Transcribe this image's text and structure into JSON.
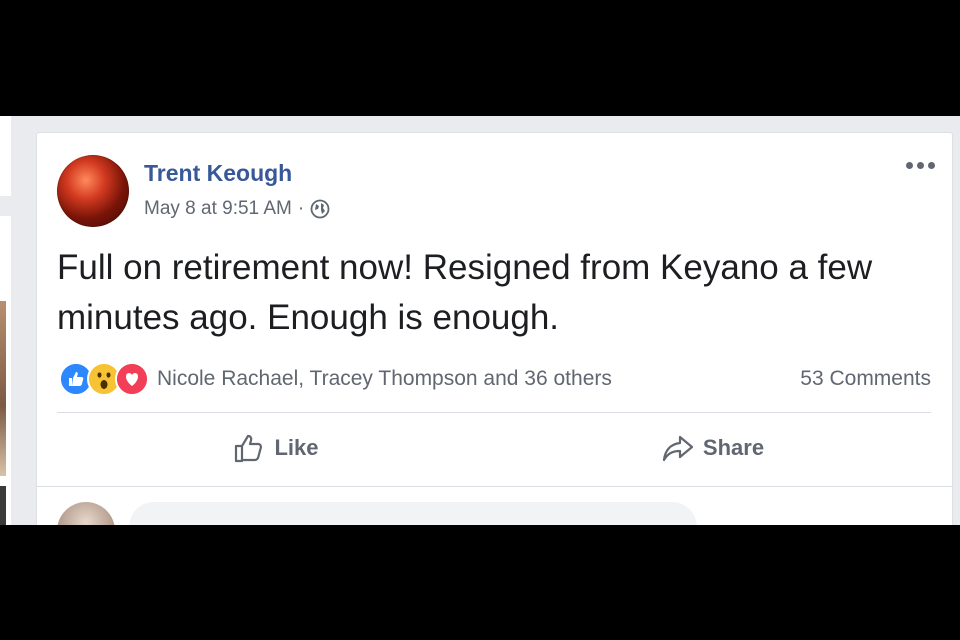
{
  "post": {
    "author": "Trent Keough",
    "timestamp": "May 8 at 9:51 AM",
    "separator": "·",
    "privacy_icon": "globe-icon",
    "text": "Full on retirement now! Resigned from Keyano a few minutes ago. Enough is enough.",
    "reactions": {
      "icons": [
        "like-icon",
        "wow-icon",
        "love-icon"
      ],
      "reacted_by": "Nicole Rachael, Tracey Thompson and 36 others",
      "comments": "53 Comments"
    },
    "actions": {
      "like_label": "Like",
      "share_label": "Share"
    }
  },
  "colors": {
    "author_link": "#385898",
    "like_reaction": "#2d88ff",
    "wow_reaction": "#f7c233",
    "love_reaction": "#f33e58",
    "page_background": "#e9ebee"
  }
}
